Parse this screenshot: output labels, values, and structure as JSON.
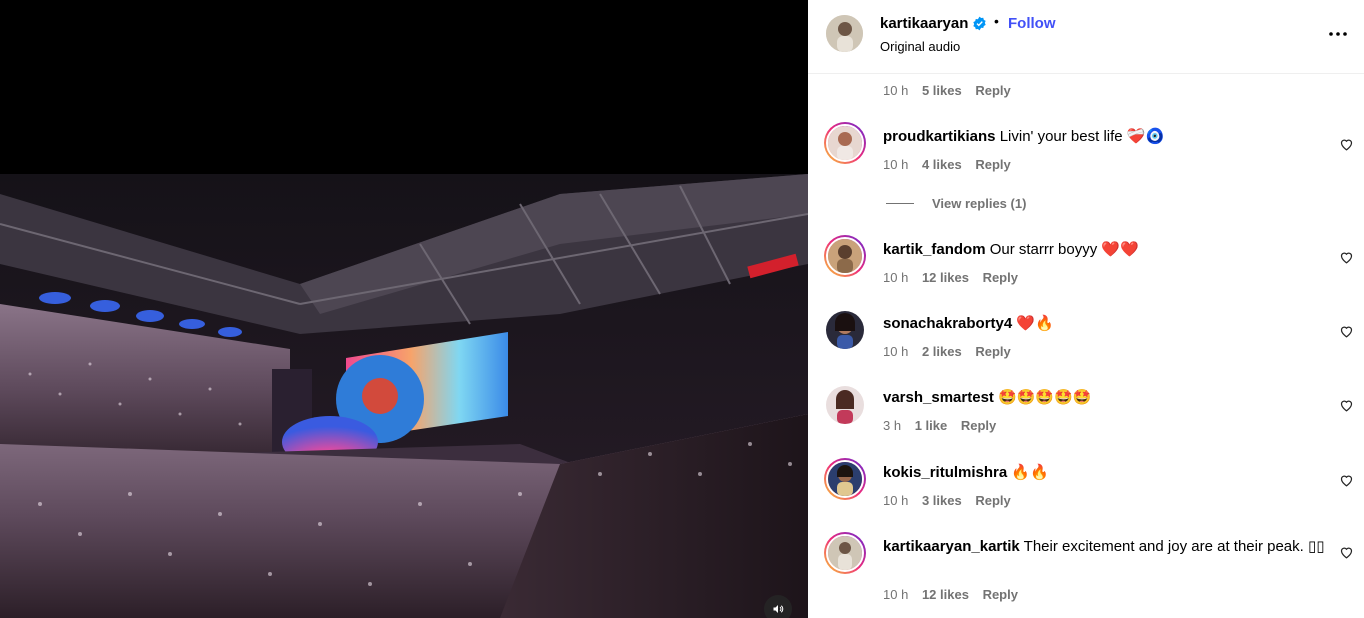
{
  "post": {
    "username": "kartikaaryan",
    "follow_label": "Follow",
    "audio_label": "Original audio",
    "separator": "•"
  },
  "colors": {
    "follow": "#4150f7",
    "verified": "#0095f6",
    "meta_text": "#737373"
  },
  "icons": {
    "verified": "verified-badge-icon",
    "more": "more-options-icon",
    "like": "heart-icon",
    "sound": "speaker-icon"
  },
  "top_meta": {
    "time": "10 h",
    "likes": "5 likes",
    "reply": "Reply"
  },
  "comments": [
    {
      "user": "proudkartikians",
      "text": "Livin' your best life ❤️‍🩹🧿",
      "time": "10 h",
      "likes": "4 likes",
      "reply": "Reply"
    },
    {
      "user": "kartik_fandom",
      "text": "Our starrr boyyy ❤️❤️",
      "time": "10 h",
      "likes": "12 likes",
      "reply": "Reply"
    },
    {
      "user": "sonachakraborty4",
      "text": "❤️🔥",
      "time": "10 h",
      "likes": "2 likes",
      "reply": "Reply"
    },
    {
      "user": "varsh_smartest",
      "text": "🤩🤩🤩🤩🤩",
      "time": "3 h",
      "likes": "1 like",
      "reply": "Reply"
    },
    {
      "user": "kokis_ritulmishra",
      "text": "🔥🔥",
      "time": "10 h",
      "likes": "3 likes",
      "reply": "Reply"
    },
    {
      "user": "kartikaaryan_kartik",
      "text": "Their excitement and joy are at their peak. ▯▯",
      "time": "10 h",
      "likes": "12 likes",
      "reply": "Reply"
    }
  ],
  "view_replies_label": "View replies (1)"
}
